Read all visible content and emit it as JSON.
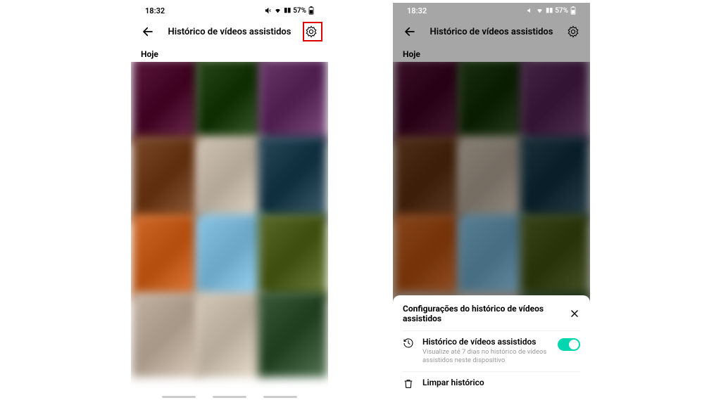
{
  "status": {
    "time": "18:32",
    "battery": "57%"
  },
  "header": {
    "title": "Histórico de vídeos assistidos"
  },
  "section": {
    "today": "Hoje"
  },
  "sheet": {
    "title": "Configurações do histórico de vídeos assistidos",
    "history_row": {
      "title": "Histórico de vídeos assistidos",
      "subtitle": "Visualize até 7 dias no histórico de vídeos assistidos neste dispositivo"
    },
    "clear_row": {
      "title": "Limpar histórico"
    }
  },
  "thumb_colors": [
    [
      "#5a1a3d",
      "#2a4a1c",
      "#6a3a6a"
    ],
    [
      "#7a4a2a",
      "#d0c4b4",
      "#2a4a5a"
    ],
    [
      "#d06a2a",
      "#8ac4e4",
      "#5a6a2a"
    ],
    [
      "#c4b4a4",
      "#d4c8b8",
      "#3a5a3a"
    ]
  ]
}
